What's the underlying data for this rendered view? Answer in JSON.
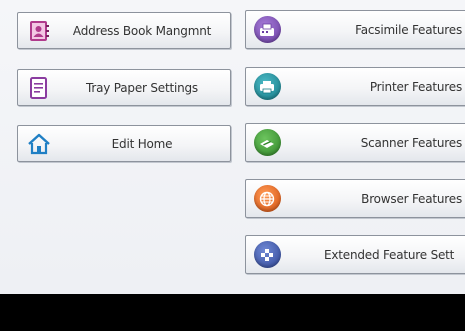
{
  "left_buttons": [
    {
      "label": "Address Book Mangmnt",
      "icon": "address-book-icon"
    },
    {
      "label": "Tray Paper Settings",
      "icon": "tray-paper-icon"
    },
    {
      "label": "Edit Home",
      "icon": "home-icon"
    }
  ],
  "right_buttons": [
    {
      "label": "Facsimile Features",
      "icon": "facsimile-icon",
      "color": "#7a4fb0"
    },
    {
      "label": "Printer Features",
      "icon": "printer-icon",
      "color": "#1f8f9a"
    },
    {
      "label": "Scanner Features",
      "icon": "scanner-icon",
      "color": "#3e9a34"
    },
    {
      "label": "Browser Features",
      "icon": "browser-icon",
      "color": "#e8641c"
    },
    {
      "label": "Extended Feature Sett",
      "icon": "extended-feature-icon",
      "color": "#3f58a8"
    }
  ]
}
